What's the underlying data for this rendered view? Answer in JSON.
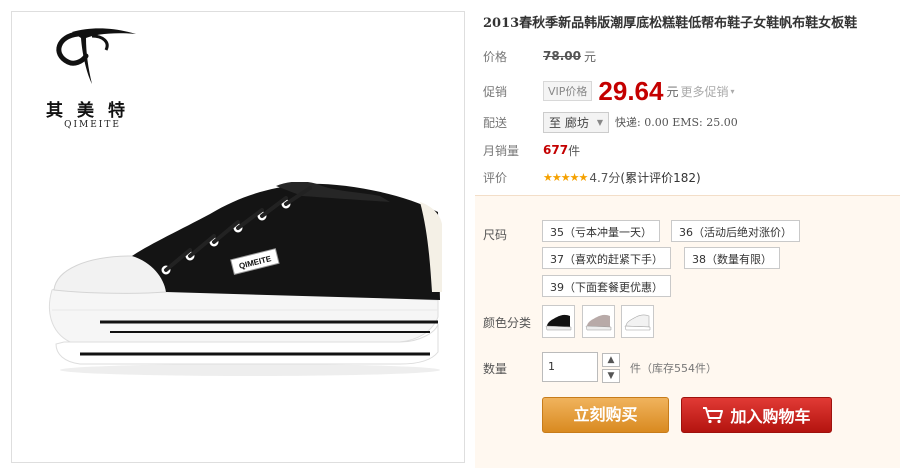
{
  "brand": {
    "name_cn": "其美特",
    "name_en": "QIMEITE"
  },
  "product": {
    "title": "2013春秋季新品韩版潮厚底松糕鞋低帮布鞋子女鞋帆布鞋女板鞋",
    "shoe_label": "QIMEITE"
  },
  "price": {
    "label": "价格",
    "original": "78.00",
    "unit": "元"
  },
  "promo": {
    "label": "促销",
    "vip_tag": "VIP价格",
    "price": "29.64",
    "unit": "元",
    "more": "更多促销"
  },
  "shipping": {
    "label": "配送",
    "destination_prefix": "至",
    "destination": "廊坊",
    "info": "快递: 0.00 EMS: 25.00"
  },
  "sales": {
    "label": "月销量",
    "count": "677",
    "unit": "件"
  },
  "rating": {
    "label": "评价",
    "stars": "★★★★★",
    "score": "4.7分",
    "count_text": "(累计评价182)",
    "value": 4.7
  },
  "options": {
    "size_label": "尺码",
    "sizes": [
      "35（亏本冲量一天）",
      "36（活动后绝对涨价）",
      "37（喜欢的赶紧下手）",
      "38（数量有限）",
      "39（下面套餐更优惠）"
    ],
    "color_label": "颜色分类",
    "colors": [
      "black",
      "grey",
      "white"
    ],
    "qty_label": "数量",
    "qty_value": "1",
    "stock_text": "件（库存554件）"
  },
  "actions": {
    "buy_now": "立刻购买",
    "add_cart": "加入购物车"
  },
  "colors": {
    "price_red": "#c40000",
    "buy_orange": "#e09a35",
    "cart_red": "#c8211c",
    "option_bg": "#fff8f0"
  }
}
